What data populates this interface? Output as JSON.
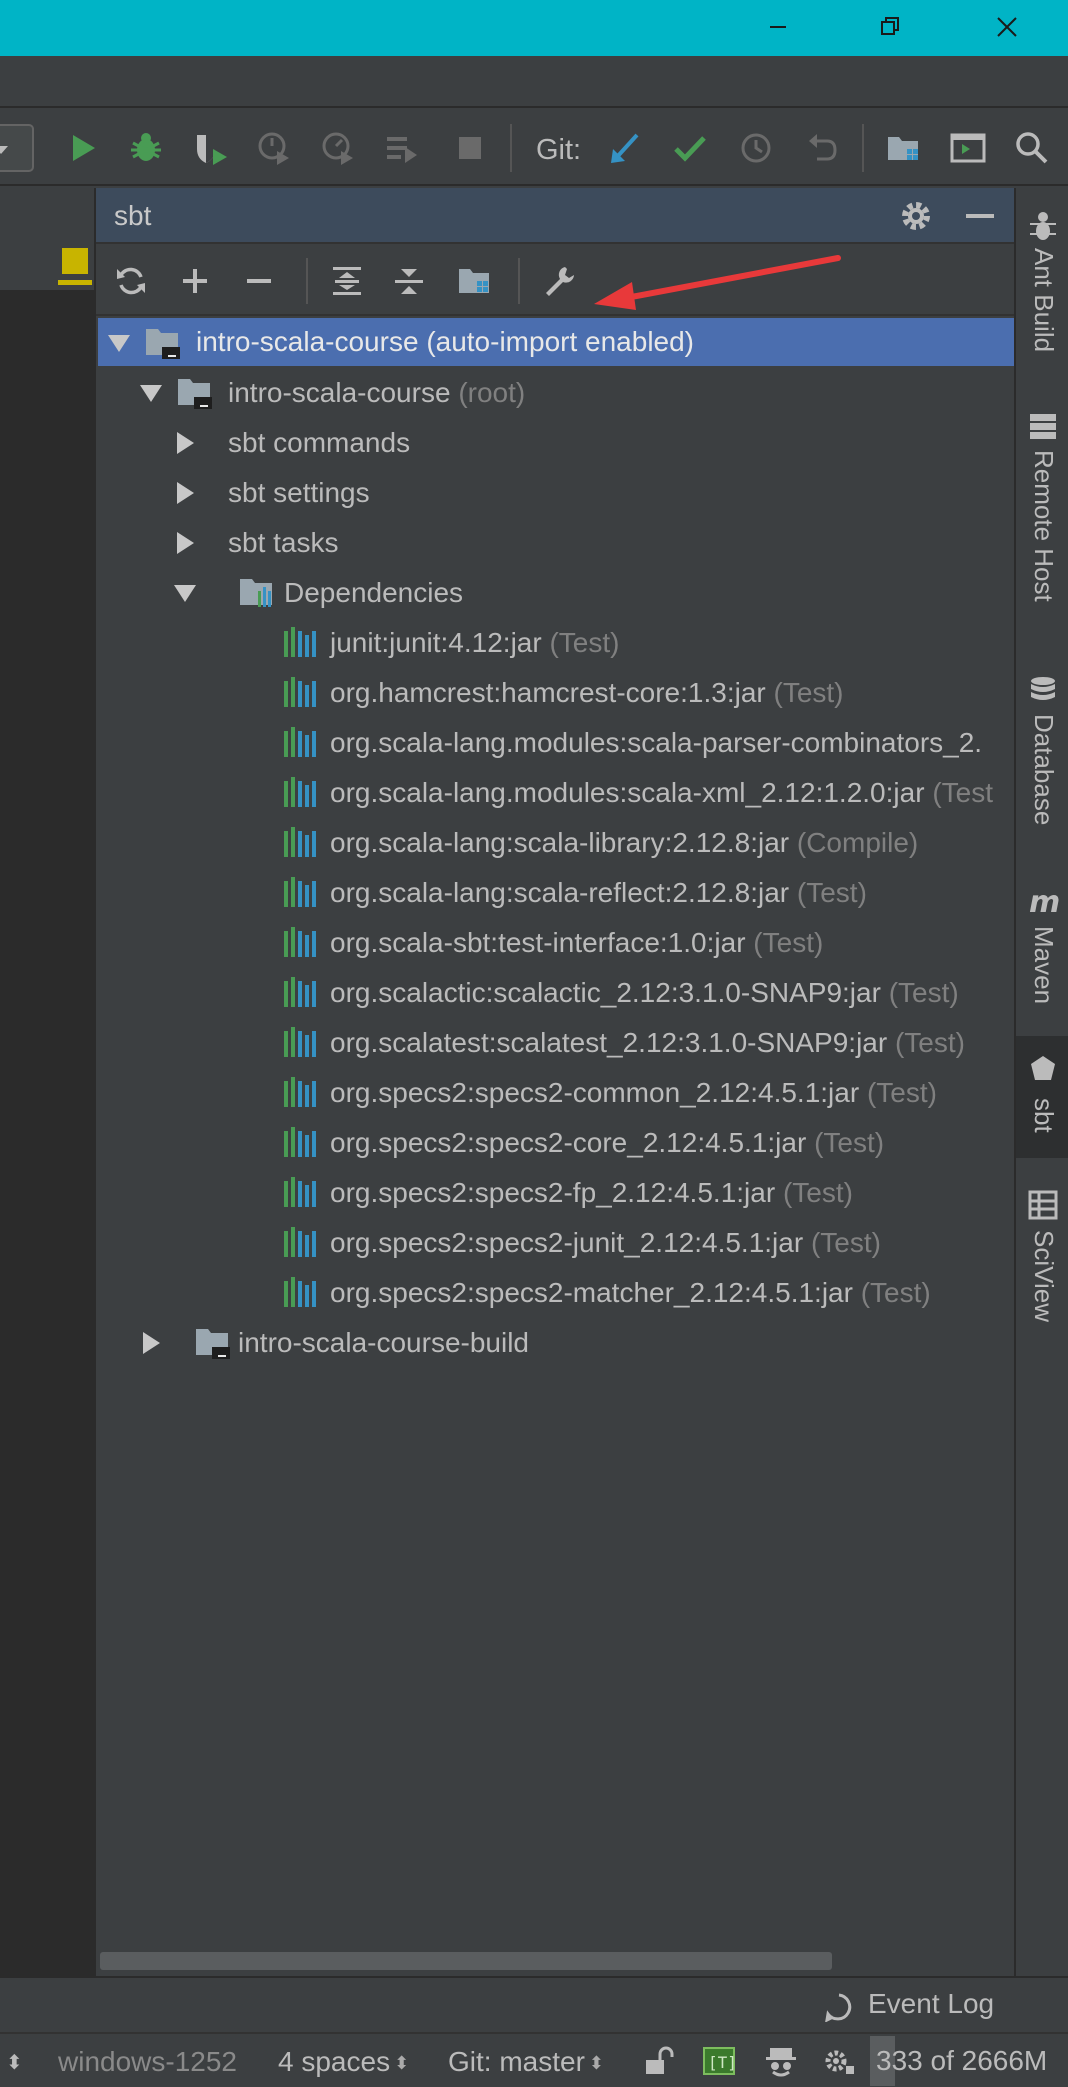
{
  "window": {
    "controls": {
      "minimize": "minimize-icon",
      "restore": "restore-icon",
      "close": "close-icon"
    },
    "accent_color": "#00b4c6"
  },
  "toolbar": {
    "git_label": "Git:",
    "icons": [
      "run-icon",
      "debug-icon",
      "coverage-icon",
      "profile-icon",
      "profile-cpu-icon",
      "run-with-icon",
      "stop-icon",
      "git-update-icon",
      "git-commit-icon",
      "git-history-icon",
      "git-revert-icon",
      "project-structure-icon",
      "terminal-icon",
      "search-icon"
    ]
  },
  "panel": {
    "title": "sbt",
    "header_icons": [
      "gear-icon",
      "hide-icon"
    ],
    "toolbar_icons": [
      "refresh-icon",
      "add-icon",
      "remove-icon",
      "expand-all-icon",
      "collapse-all-icon",
      "project-settings-icon",
      "sbt-settings-wrench-icon"
    ],
    "tree": {
      "root": {
        "name": "intro-scala-course",
        "suffix": "(auto-import enabled)"
      },
      "module": {
        "name": "intro-scala-course",
        "tag": "(root)"
      },
      "nodes": [
        "sbt commands",
        "sbt settings",
        "sbt tasks"
      ],
      "dependencies_label": "Dependencies",
      "dependencies": [
        {
          "name": "junit:junit:4.12:jar",
          "scope": "(Test)"
        },
        {
          "name": "org.hamcrest:hamcrest-core:1.3:jar",
          "scope": "(Test)"
        },
        {
          "name": "org.scala-lang.modules:scala-parser-combinators_2.",
          "scope": ""
        },
        {
          "name": "org.scala-lang.modules:scala-xml_2.12:1.2.0:jar",
          "scope": "(Test"
        },
        {
          "name": "org.scala-lang:scala-library:2.12.8:jar",
          "scope": "(Compile)"
        },
        {
          "name": "org.scala-lang:scala-reflect:2.12.8:jar",
          "scope": "(Test)"
        },
        {
          "name": "org.scala-sbt:test-interface:1.0:jar",
          "scope": "(Test)"
        },
        {
          "name": "org.scalactic:scalactic_2.12:3.1.0-SNAP9:jar",
          "scope": "(Test)"
        },
        {
          "name": "org.scalatest:scalatest_2.12:3.1.0-SNAP9:jar",
          "scope": "(Test)"
        },
        {
          "name": "org.specs2:specs2-common_2.12:4.5.1:jar",
          "scope": "(Test)"
        },
        {
          "name": "org.specs2:specs2-core_2.12:4.5.1:jar",
          "scope": "(Test)"
        },
        {
          "name": "org.specs2:specs2-fp_2.12:4.5.1:jar",
          "scope": "(Test)"
        },
        {
          "name": "org.specs2:specs2-junit_2.12:4.5.1:jar",
          "scope": "(Test)"
        },
        {
          "name": "org.specs2:specs2-matcher_2.12:4.5.1:jar",
          "scope": "(Test)"
        }
      ],
      "build_module": "intro-scala-course-build"
    }
  },
  "right_tabs": [
    {
      "label": "Ant Build",
      "icon": "ant-icon"
    },
    {
      "label": "Remote Host",
      "icon": "remote-host-icon"
    },
    {
      "label": "Database",
      "icon": "database-icon"
    },
    {
      "label": "Maven",
      "icon": "maven-icon"
    },
    {
      "label": "sbt",
      "icon": "sbt-icon"
    },
    {
      "label": "SciView",
      "icon": "sciview-icon"
    }
  ],
  "bottom": {
    "event_log": "Event Log"
  },
  "status": {
    "encoding": "windows-1252",
    "indent": "4 spaces",
    "git_branch": "Git: master",
    "memory": "333 of 2666M",
    "memory_fraction": 0.125
  },
  "annotation": {
    "arrow_color": "#e8393a"
  }
}
